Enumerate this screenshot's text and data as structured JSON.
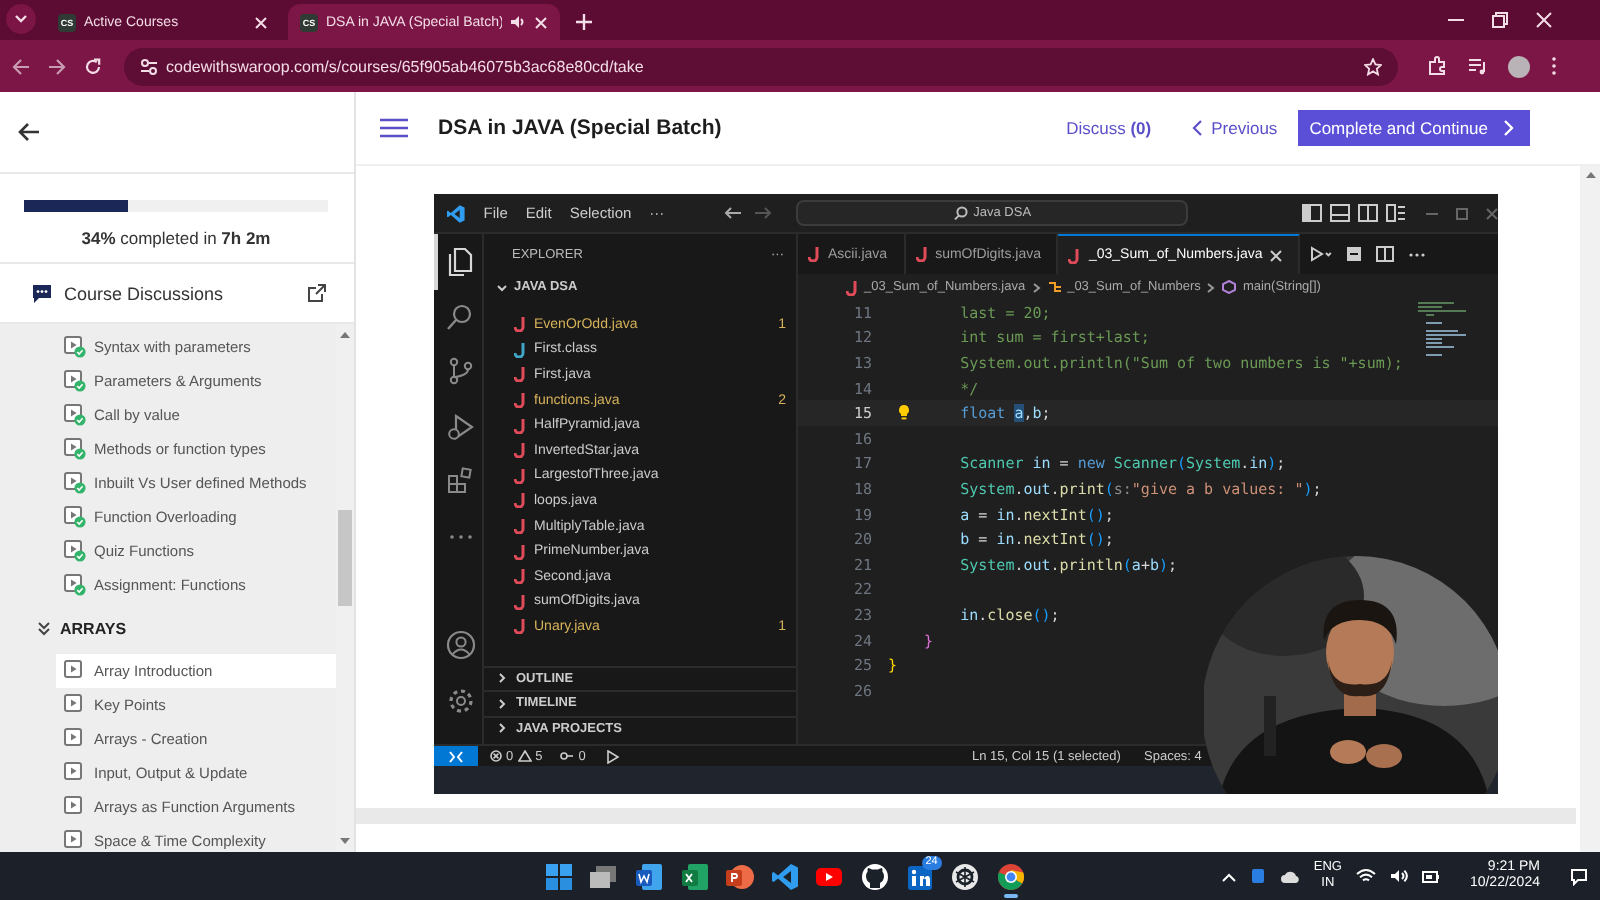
{
  "browser": {
    "tabs": [
      {
        "favicon_text": "CS",
        "title": "Active Courses",
        "audio": false,
        "selected": false
      },
      {
        "favicon_text": "CS",
        "title": "DSA in JAVA (Special Batch)",
        "audio": true,
        "selected": true
      }
    ],
    "url": "codewithswaroop.com/s/courses/65f905ab46075b3ac68e80cd/take"
  },
  "sidebar": {
    "progress": {
      "level": 0.34,
      "text": "**34%** completed in **7h 2m**"
    },
    "discussions": "Course Discussions",
    "lessons": [
      {
        "title": "Syntax with parameters",
        "completed": true,
        "selected": false
      },
      {
        "title": "Parameters & Arguments",
        "completed": true,
        "selected": false
      },
      {
        "title": "Call by value",
        "completed": true,
        "selected": false
      },
      {
        "title": "Methods or function types",
        "completed": true,
        "selected": false
      },
      {
        "title": "Inbuilt Vs User defined Methods",
        "completed": true,
        "selected": false
      },
      {
        "title": "Function Overloading",
        "completed": true,
        "selected": false
      },
      {
        "title": "Quiz Functions",
        "completed": true,
        "selected": false
      },
      {
        "title": "Assignment: Functions",
        "completed": true,
        "selected": false
      }
    ],
    "sections": [
      {
        "title": "ARRAYS",
        "expanded": true,
        "lessons": [
          {
            "title": "Array Introduction",
            "completed": false,
            "selected": true
          },
          {
            "title": "Key Points",
            "completed": false,
            "selected": false
          },
          {
            "title": "Arrays - Creation",
            "completed": false,
            "selected": false
          },
          {
            "title": "Input, Output & Update",
            "completed": false,
            "selected": false
          },
          {
            "title": "Arrays as Function Arguments",
            "completed": false,
            "selected": false
          },
          {
            "title": "Space & Time Complexity",
            "completed": false,
            "selected": false
          }
        ]
      }
    ]
  },
  "header": {
    "title": "DSA in JAVA (Special Batch)",
    "discuss": "Discuss **(0)**",
    "previous": "Previous",
    "complete": "Complete and Continue"
  },
  "vscode": {
    "menu": [
      "File",
      "Edit",
      "Selection",
      "···"
    ],
    "search": "Java DSA",
    "activity": [
      {
        "kind": "explorer",
        "selected": true
      },
      {
        "kind": "search",
        "selected": false
      },
      {
        "kind": "source-control",
        "selected": false
      },
      {
        "kind": "run",
        "selected": false
      },
      {
        "kind": "extensions",
        "selected": false
      },
      {
        "kind": "more",
        "selected": false
      }
    ],
    "activity_bottom": [
      {
        "kind": "account"
      },
      {
        "kind": "settings"
      }
    ],
    "explorer": {
      "title": "EXPLORER",
      "actions": "···",
      "folder": "JAVA DSA",
      "expanded": true,
      "files": [
        {
          "name": "EvenOrOdd.java",
          "kind": "java",
          "modified": true,
          "problems": "1"
        },
        {
          "name": "First.class",
          "kind": "class",
          "modified": false
        },
        {
          "name": "First.java",
          "kind": "java",
          "modified": false
        },
        {
          "name": "functions.java",
          "kind": "java",
          "modified": true,
          "problems": "2"
        },
        {
          "name": "HalfPyramid.java",
          "kind": "java",
          "modified": false
        },
        {
          "name": "InvertedStar.java",
          "kind": "java",
          "modified": false
        },
        {
          "name": "LargestofThree.java",
          "kind": "java",
          "modified": false
        },
        {
          "name": "loops.java",
          "kind": "java",
          "modified": false
        },
        {
          "name": "MultiplyTable.java",
          "kind": "java",
          "modified": false
        },
        {
          "name": "PrimeNumber.java",
          "kind": "java",
          "modified": false
        },
        {
          "name": "Second.java",
          "kind": "java",
          "modified": false
        },
        {
          "name": "sumOfDigits.java",
          "kind": "java",
          "modified": false
        },
        {
          "name": "Unary.java",
          "kind": "java",
          "modified": true,
          "problems": "1"
        }
      ],
      "panels": [
        {
          "title": "OUTLINE",
          "expanded": false
        },
        {
          "title": "TIMELINE",
          "expanded": false
        },
        {
          "title": "JAVA PROJECTS",
          "expanded": false
        }
      ]
    },
    "tabs": [
      {
        "name": "Ascii.java",
        "selected": false
      },
      {
        "name": "sumOfDigits.java",
        "selected": false
      },
      {
        "name": "_03_Sum_of_Numbers.java",
        "selected": true
      }
    ],
    "breadcrumb": [
      "_03_Sum_of_Numbers.java",
      "_03_Sum_of_Numbers",
      "main(String[])"
    ],
    "lines": [
      {
        "number": "11",
        "current": false,
        "lightbulb": false,
        "tokens": [
          {
            "text": "        last = 20;",
            "kind": "comment"
          }
        ]
      },
      {
        "number": "12",
        "current": false,
        "lightbulb": false,
        "tokens": [
          {
            "text": "        int sum = first+last;",
            "kind": "comment"
          }
        ]
      },
      {
        "number": "13",
        "current": false,
        "lightbulb": false,
        "tokens": [
          {
            "text": "        System.out.println(\"Sum of two numbers is \"+sum);",
            "kind": "comment"
          }
        ]
      },
      {
        "number": "14",
        "current": false,
        "lightbulb": false,
        "tokens": [
          {
            "text": "        */",
            "kind": "comment"
          }
        ]
      },
      {
        "number": "15",
        "current": true,
        "lightbulb": true,
        "tokens": [
          {
            "text": "        float ",
            "kind": "keyword"
          },
          {
            "text": "a",
            "kind": "selection"
          },
          {
            "text": ",",
            "kind": "plain"
          },
          {
            "text": "b",
            "kind": "variable"
          },
          {
            "text": ";",
            "kind": "plain"
          }
        ]
      },
      {
        "number": "16",
        "current": false,
        "lightbulb": false
      },
      {
        "number": "17",
        "current": false,
        "lightbulb": false,
        "tokens": [
          {
            "text": "        Scanner",
            "kind": "type"
          },
          {
            "text": " in",
            "kind": "variable"
          },
          {
            "text": " = ",
            "kind": "plain"
          },
          {
            "text": "new ",
            "kind": "keyword"
          },
          {
            "text": "Scanner",
            "kind": "type"
          },
          {
            "text": "(",
            "kind": "paren"
          },
          {
            "text": "System",
            "kind": "type"
          },
          {
            "text": ".",
            "kind": "plain"
          },
          {
            "text": "in",
            "kind": "variable"
          },
          {
            "text": ")",
            "kind": "paren"
          },
          {
            "text": ";",
            "kind": "plain"
          }
        ]
      },
      {
        "number": "18",
        "current": false,
        "lightbulb": false,
        "tokens": [
          {
            "text": "        System",
            "kind": "type"
          },
          {
            "text": ".",
            "kind": "plain"
          },
          {
            "text": "out",
            "kind": "variable"
          },
          {
            "text": ".",
            "kind": "plain"
          },
          {
            "text": "print",
            "kind": "function"
          },
          {
            "text": "(",
            "kind": "paren"
          },
          {
            "text": "s:",
            "kind": "hint"
          },
          {
            "text": "\"give a b values: \"",
            "kind": "string"
          },
          {
            "text": ")",
            "kind": "paren"
          },
          {
            "text": ";",
            "kind": "plain"
          }
        ]
      },
      {
        "number": "19",
        "current": false,
        "lightbulb": false,
        "tokens": [
          {
            "text": "        a",
            "kind": "variable"
          },
          {
            "text": " = ",
            "kind": "plain"
          },
          {
            "text": "in",
            "kind": "variable"
          },
          {
            "text": ".",
            "kind": "plain"
          },
          {
            "text": "nextInt",
            "kind": "function"
          },
          {
            "text": "()",
            "kind": "paren"
          },
          {
            "text": ";",
            "kind": "plain"
          }
        ]
      },
      {
        "number": "20",
        "current": false,
        "lightbulb": false,
        "tokens": [
          {
            "text": "        b",
            "kind": "variable"
          },
          {
            "text": " = ",
            "kind": "plain"
          },
          {
            "text": "in",
            "kind": "variable"
          },
          {
            "text": ".",
            "kind": "plain"
          },
          {
            "text": "nextInt",
            "kind": "function"
          },
          {
            "text": "()",
            "kind": "paren"
          },
          {
            "text": ";",
            "kind": "plain"
          }
        ]
      },
      {
        "number": "21",
        "current": false,
        "lightbulb": false,
        "tokens": [
          {
            "text": "        System",
            "kind": "type"
          },
          {
            "text": ".",
            "kind": "plain"
          },
          {
            "text": "out",
            "kind": "variable"
          },
          {
            "text": ".",
            "kind": "plain"
          },
          {
            "text": "println",
            "kind": "function"
          },
          {
            "text": "(",
            "kind": "paren"
          },
          {
            "text": "a",
            "kind": "variable"
          },
          {
            "text": "+",
            "kind": "plain"
          },
          {
            "text": "b",
            "kind": "variable"
          },
          {
            "text": ")",
            "kind": "paren"
          },
          {
            "text": ";",
            "kind": "plain"
          }
        ]
      },
      {
        "number": "22",
        "current": false,
        "lightbulb": false
      },
      {
        "number": "23",
        "current": false,
        "lightbulb": false,
        "tokens": [
          {
            "text": "        in",
            "kind": "variable"
          },
          {
            "text": ".",
            "kind": "plain"
          },
          {
            "text": "close",
            "kind": "function"
          },
          {
            "text": "()",
            "kind": "paren"
          },
          {
            "text": ";",
            "kind": "plain"
          }
        ]
      },
      {
        "number": "24",
        "current": false,
        "lightbulb": false,
        "tokens": [
          {
            "text": "    }",
            "kind": "brace"
          }
        ]
      },
      {
        "number": "25",
        "current": false,
        "lightbulb": false,
        "tokens": [
          {
            "text": "}",
            "kind": "brace-outer"
          }
        ]
      },
      {
        "number": "26",
        "current": false,
        "lightbulb": false
      }
    ],
    "status": {
      "errors": "0",
      "warnings": "5",
      "ports": "0",
      "position": "Ln 15, Col 15 (1 selected)",
      "spaces": "Spaces: 4"
    }
  },
  "taskbar": {
    "apps": [
      {
        "kind": "start",
        "active": false
      },
      {
        "kind": "task-view",
        "active": false
      },
      {
        "kind": "word",
        "active": false
      },
      {
        "kind": "excel",
        "active": false
      },
      {
        "kind": "powerpoint",
        "active": false
      },
      {
        "kind": "vscode",
        "active": false
      },
      {
        "kind": "youtube",
        "active": false
      },
      {
        "kind": "github",
        "active": false
      },
      {
        "kind": "linkedin",
        "active": false,
        "badge": "24"
      },
      {
        "kind": "chatgpt",
        "active": false
      },
      {
        "kind": "chrome",
        "active": true
      }
    ],
    "language": "ENG",
    "region": "IN",
    "time": "9:21 PM",
    "date": "10/22/2024"
  }
}
